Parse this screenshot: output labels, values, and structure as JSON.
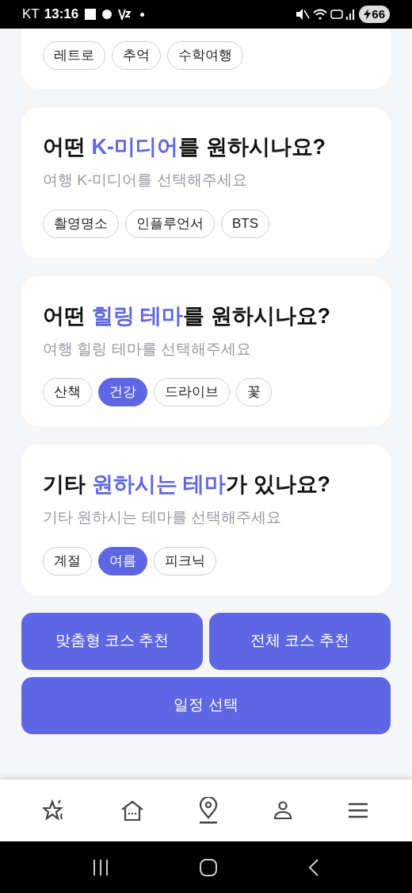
{
  "status_bar": {
    "carrier": "KT",
    "time": "13:16",
    "battery": "66"
  },
  "cards": [
    {
      "chips": [
        {
          "label": "레트로",
          "selected": false
        },
        {
          "label": "추억",
          "selected": false
        },
        {
          "label": "수학여행",
          "selected": false
        }
      ]
    },
    {
      "title": {
        "before": "어떤 ",
        "highlight": "K-미디어",
        "after": "를 원하시나요?"
      },
      "subtitle": "여행 K-미디어를 선택해주세요",
      "chips": [
        {
          "label": "촬영명소",
          "selected": false
        },
        {
          "label": "인플루언서",
          "selected": false
        },
        {
          "label": "BTS",
          "selected": false
        }
      ]
    },
    {
      "title": {
        "before": "어떤 ",
        "highlight": "힐링 테마",
        "after": "를 원하시나요?"
      },
      "subtitle": "여행 힐링 테마를 선택해주세요",
      "chips": [
        {
          "label": "산책",
          "selected": false
        },
        {
          "label": "건강",
          "selected": true
        },
        {
          "label": "드라이브",
          "selected": false
        },
        {
          "label": "꽃",
          "selected": false
        }
      ]
    },
    {
      "title": {
        "before": "기타 ",
        "highlight": "원하시는 테마",
        "after": "가 있나요?"
      },
      "subtitle": "기타 원하시는 테마를 선택해주세요",
      "chips": [
        {
          "label": "계절",
          "selected": false
        },
        {
          "label": "여름",
          "selected": true
        },
        {
          "label": "피크닉",
          "selected": false
        }
      ]
    }
  ],
  "action_buttons": [
    {
      "label": "맞춤형 코스 추천"
    },
    {
      "label": "전체 코스 추천"
    }
  ],
  "schedule_button": {
    "label": "일정 선택"
  }
}
